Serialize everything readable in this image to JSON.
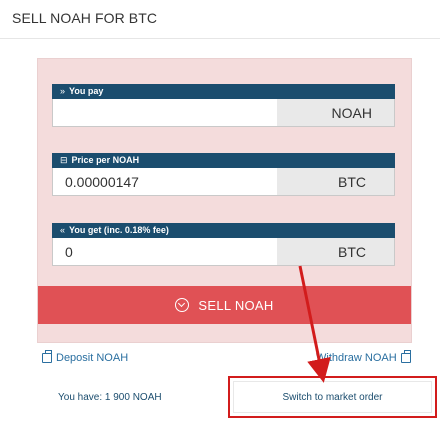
{
  "header": {
    "title": "SELL NOAH FOR BTC"
  },
  "form": {
    "pay": {
      "label": "You pay",
      "glyph": "»",
      "value": "",
      "unit": "NOAH"
    },
    "price": {
      "label": "Price per NOAH",
      "glyph": "⊟",
      "value": "0.00000147",
      "unit": "BTC"
    },
    "get": {
      "label": "You get (inc. 0.18% fee)",
      "glyph": "«",
      "value": "0",
      "unit": "BTC"
    },
    "sell_label": "SELL NOAH"
  },
  "links": {
    "deposit": "Deposit NOAH",
    "withdraw": "Withdraw NOAH"
  },
  "footer": {
    "balance": "You have: 1 900 NOAH",
    "market_label": "Switch to market order"
  },
  "colors": {
    "header_bar": "#1b4d6e",
    "sell_button": "#e05155",
    "panel_bg": "#f4dcdc",
    "highlight": "#d21c1c",
    "link": "#2a6fa0"
  }
}
